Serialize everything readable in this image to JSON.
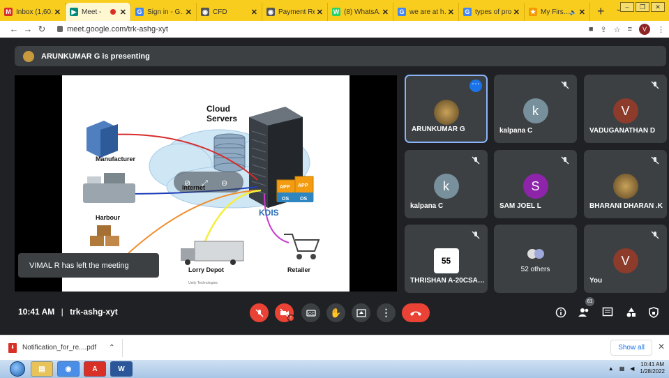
{
  "browser": {
    "tabs": [
      {
        "label": "Inbox (1,60…",
        "fav": "M",
        "color": "#d93025"
      },
      {
        "label": "Meet -",
        "fav": "▶",
        "color": "#00897b",
        "active": true,
        "recording": true
      },
      {
        "label": "Sign in - G…",
        "fav": "G",
        "color": "#4285f4"
      },
      {
        "label": "CFD",
        "fav": "◉",
        "color": "#555555"
      },
      {
        "label": "Payment Re…",
        "fav": "◉",
        "color": "#555555"
      },
      {
        "label": "(8) WhatsA…",
        "fav": "W",
        "color": "#25d366"
      },
      {
        "label": "we are at h…",
        "fav": "G",
        "color": "#4285f4"
      },
      {
        "label": "types of pro…",
        "fav": "G",
        "color": "#4285f4"
      },
      {
        "label": "My Firs…",
        "fav": "★",
        "color": "#f29900",
        "audio": true
      }
    ],
    "new_tab": "+",
    "url": "meet.google.com/trk-ashg-xyt",
    "profile_initial": "V"
  },
  "meet": {
    "presenting_text": "ARUNKUMAR G is presenting",
    "toast": "VIMAL R has left the meeting",
    "time": "10:41 AM",
    "separator": "|",
    "meeting_code": "trk-ashg-xyt",
    "people_count": "61",
    "participants": [
      {
        "name": "ARUNKUMAR G",
        "avatar": "photo",
        "selected": true
      },
      {
        "name": "kalpana C",
        "initial": "k",
        "color": "#78909c"
      },
      {
        "name": "VADUGANATHAN D",
        "initial": "V",
        "color": "#8d3b2b"
      },
      {
        "name": "kalpana C",
        "initial": "k",
        "color": "#78909c"
      },
      {
        "name": "SAM JOEL L",
        "initial": "S",
        "color": "#8e24aa"
      },
      {
        "name": "BHARANI DHARAN .K",
        "avatar": "photo"
      },
      {
        "name": "THRISHAN A-20CSA…",
        "avatar": "speed-sign"
      },
      {
        "name": "52 others",
        "avatar": "group"
      },
      {
        "name": "You",
        "initial": "V",
        "color": "#8d3b2b"
      }
    ]
  },
  "slide": {
    "cloud_label": "Cloud\nServers",
    "manufacturer": "Manufacturer",
    "internet": "Internet",
    "harbour": "Harbour",
    "kdis": "KDIS",
    "lorry": "Lorry Depot",
    "retailer": "Retailer",
    "footer": "Unity Technologies",
    "app1": "APP",
    "os1": "OS",
    "app2": "APP",
    "os2": "OS"
  },
  "downloads": {
    "file": "Notification_for_re....pdf",
    "show_all": "Show all"
  },
  "taskbar": {
    "time": "10:41 AM",
    "date": "1/28/2022"
  }
}
